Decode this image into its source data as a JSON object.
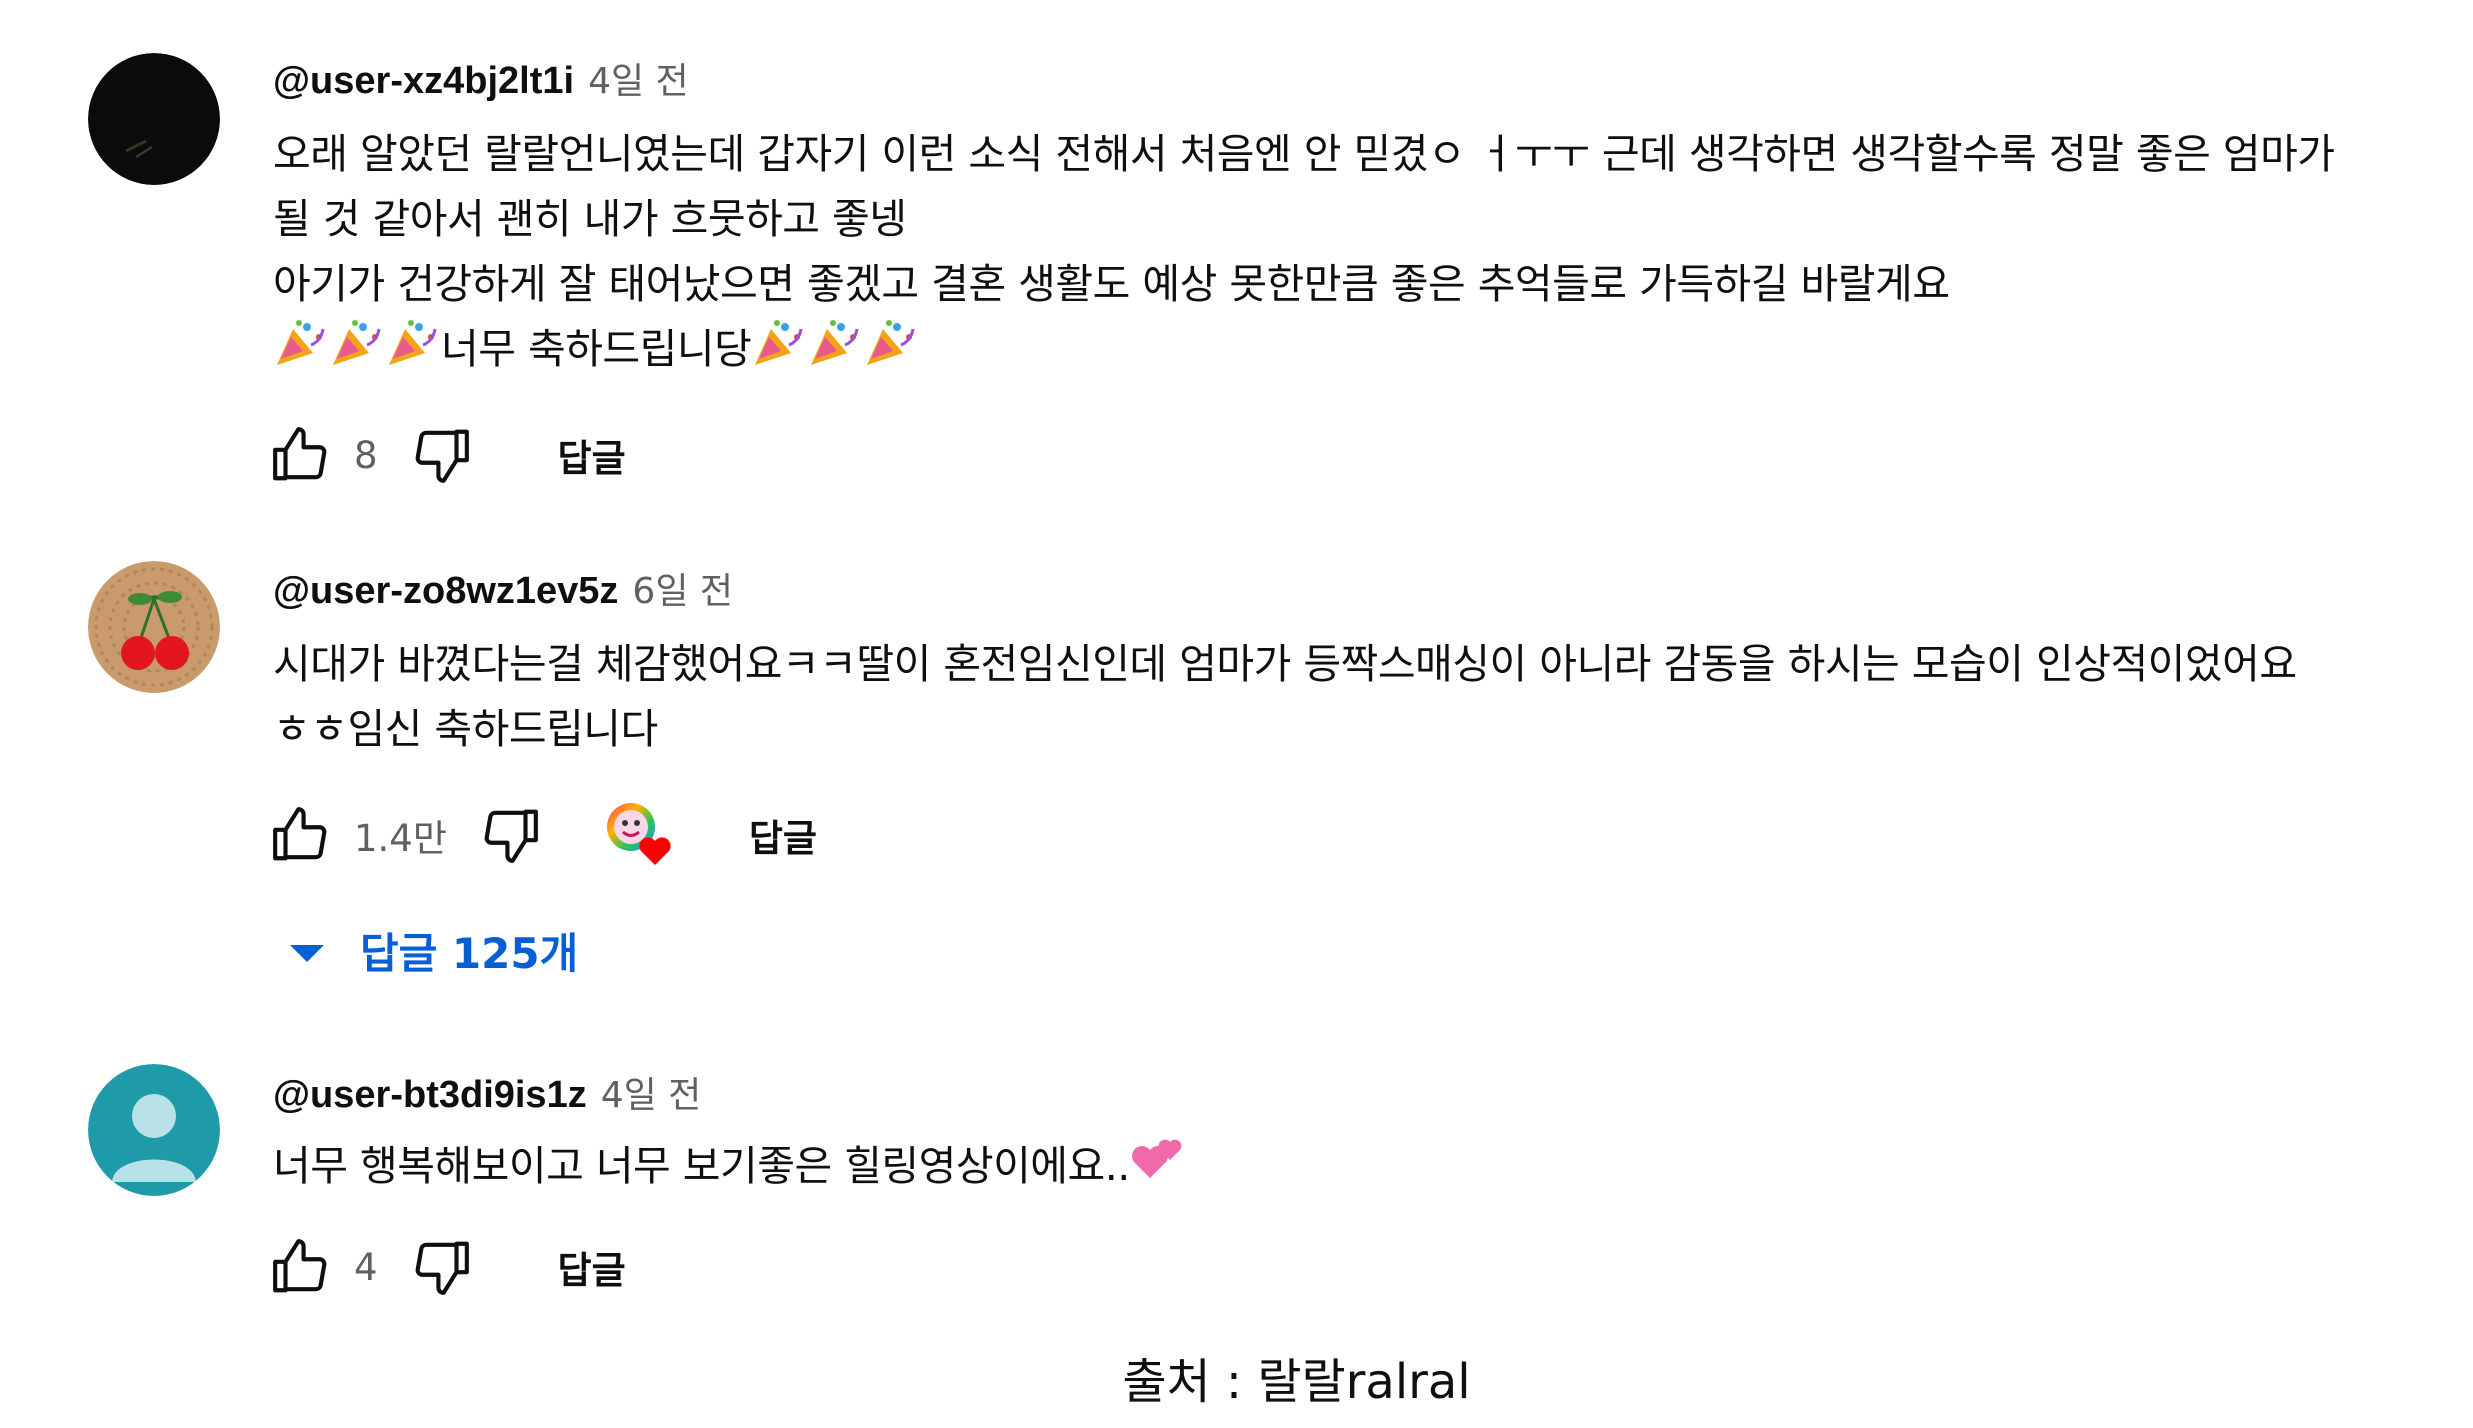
{
  "comments": [
    {
      "handle": "@user-xz4bj2lt1i",
      "time": "4일 전",
      "lines": [
        "오래 알았던 랄랄언니였는데 갑자기 이런 소식 전해서 처음엔 안 믿겼ㅇ ㅓㅜㅜ 근데 생각하면 생각할수록 정말 좋은 엄마가",
        "될 것 같아서 괜히 내가 흐뭇하고 좋넹",
        "아기가 건강하게 잘 태어났으면 좋겠고 결혼 생활도 예상 못한만큼 좋은 추억들로 가득하길 바랄게요"
      ],
      "celebrate_text": "너무 축하드립니당",
      "likes": "8",
      "reply_label": "답글"
    },
    {
      "handle": "@user-zo8wz1ev5z",
      "time": "6일 전",
      "lines": [
        "시대가 바꼈다는걸 체감했어요ㅋㅋ딸이 혼전임신인데 엄마가 등짝스매싱이 아니라 감동을 하시는 모습이 인상적이었어요",
        "ㅎㅎ임신 축하드립니다"
      ],
      "likes": "1.4만",
      "reply_label": "답글",
      "replies_label": "답글 125개"
    },
    {
      "handle": "@user-bt3di9is1z",
      "time": "4일 전",
      "text": "너무 행복해보이고 너무 보기좋은 힐링영상이에요..",
      "likes": "4",
      "reply_label": "답글"
    }
  ],
  "source": "출처 : 랄랄ralral",
  "icons": {
    "like": "thumbs-up-icon",
    "dislike": "thumbs-down-icon",
    "party": "party-popper-emoji",
    "hearts": "two-hearts-emoji",
    "creator_heart": "creator-heart-badge",
    "expand": "caret-down-icon"
  },
  "colors": {
    "link_blue": "#065fd4",
    "secondary_text": "#606060",
    "avatar_teal": "#1e9aa8"
  }
}
